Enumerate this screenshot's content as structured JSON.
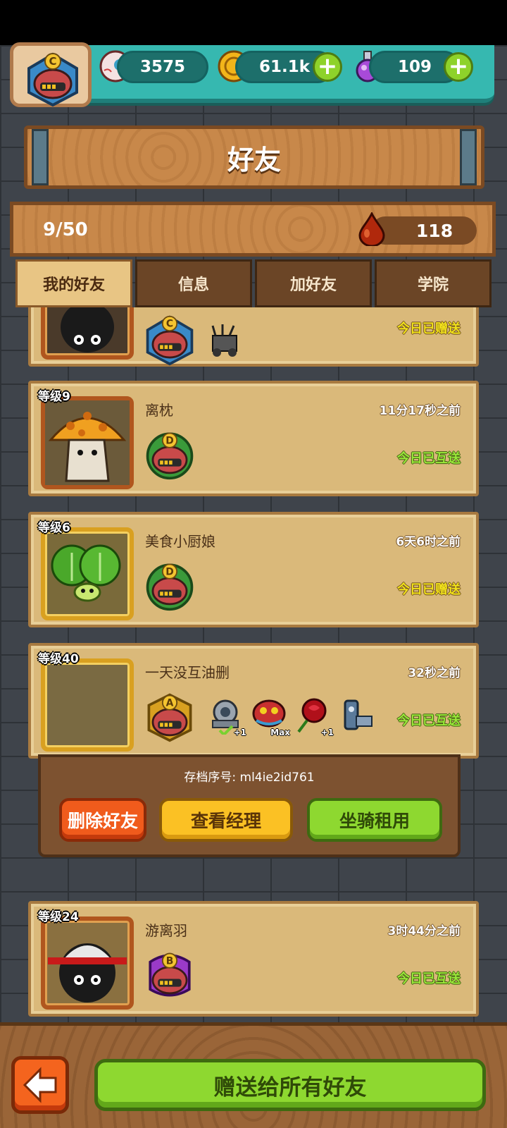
{
  "resources": {
    "eyes": "3575",
    "coins": "61.1k",
    "potions": "109"
  },
  "player_rank": "C",
  "title": "好友",
  "friend_count": "9/50",
  "blood_drops": "118",
  "tabs": [
    "我的好友",
    "信息",
    "加好友",
    "学院"
  ],
  "active_tab": 0,
  "friends": [
    {
      "level": "",
      "name": "",
      "time": "",
      "status": "今日已赠送",
      "status_type": "give",
      "rank": "C"
    },
    {
      "level": "等级9",
      "name": "离枕",
      "time": "11分17秒之前",
      "status": "今日已互送",
      "status_type": "mutual",
      "rank": "D"
    },
    {
      "level": "等级6",
      "name": "美食小厨娘",
      "time": "6天6时之前",
      "status": "今日已赠送",
      "status_type": "give",
      "rank": "D"
    },
    {
      "level": "等级40",
      "name": "一天没互油删",
      "time": "32秒之前",
      "status": "今日已互送",
      "status_type": "mutual",
      "rank": "A",
      "gear_tags": [
        "+1",
        "Max",
        "+1",
        ""
      ]
    },
    {
      "level": "等级24",
      "name": "游离羽",
      "time": "3时44分之前",
      "status": "今日已互送",
      "status_type": "mutual",
      "rank": "B"
    }
  ],
  "expanded_panel": {
    "save_id": "存档序号: ml4ie2id761",
    "delete_label": "删除好友",
    "view_label": "查看经理",
    "mount_label": "坐骑租用"
  },
  "gift_all_label": "赠送给所有好友",
  "colors": {
    "wood": "#c8884a",
    "teal": "#36b8b0",
    "green_button": "#8ed830",
    "red_button": "#f05b1c",
    "yellow_button": "#fbc124"
  }
}
